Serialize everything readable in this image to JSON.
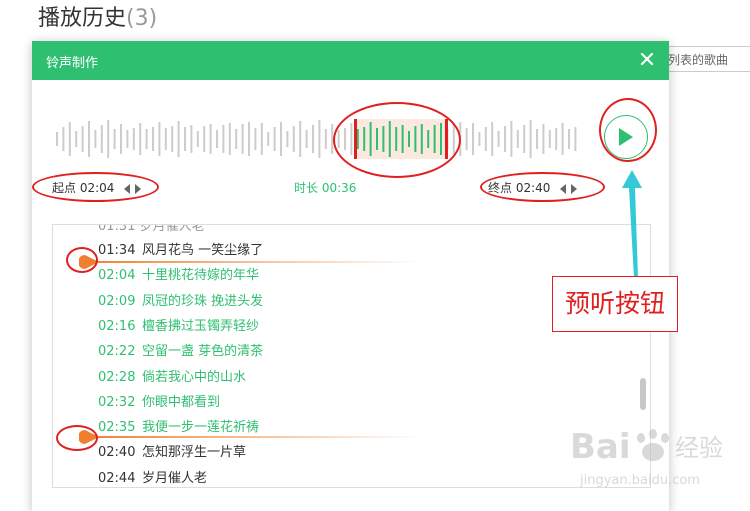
{
  "background": {
    "title": "播放历史",
    "count": "(3)",
    "search_hint": "列表的歌曲"
  },
  "dialog": {
    "title": "铃声制作",
    "close_icon": "close-icon",
    "start_label": "起点",
    "start_time": "02:04",
    "duration_label": "时长",
    "duration": "00:36",
    "end_label": "终点",
    "end_time": "02:40",
    "play_icon": "play-icon"
  },
  "lyrics": [
    {
      "time": "01:34",
      "text": "风月花鸟 一笑尘缘了",
      "selected": false
    },
    {
      "time": "02:04",
      "text": "十里桃花待嫁的年华",
      "selected": true
    },
    {
      "time": "02:09",
      "text": "凤冠的珍珠 挽进头发",
      "selected": true
    },
    {
      "time": "02:16",
      "text": "檀香拂过玉镯弄轻纱",
      "selected": true
    },
    {
      "time": "02:22",
      "text": "空留一盏 芽色的清茶",
      "selected": true
    },
    {
      "time": "02:28",
      "text": "倘若我心中的山水",
      "selected": true
    },
    {
      "time": "02:32",
      "text": "你眼中都看到",
      "selected": true
    },
    {
      "time": "02:35",
      "text": "我便一步一莲花祈祷",
      "selected": true
    },
    {
      "time": "02:40",
      "text": "怎知那浮生一片草",
      "selected": false
    },
    {
      "time": "02:44",
      "text": "岁月催人老",
      "selected": false
    }
  ],
  "annotation": {
    "label": "预听按钮"
  },
  "watermark": {
    "brand": "Bai",
    "brand2": "经验",
    "url": "jingyan.baidu.com"
  },
  "colors": {
    "accent": "#2fbf71",
    "annotation": "#e02020",
    "marker": "#f08030",
    "arrow": "#33c9d6"
  }
}
